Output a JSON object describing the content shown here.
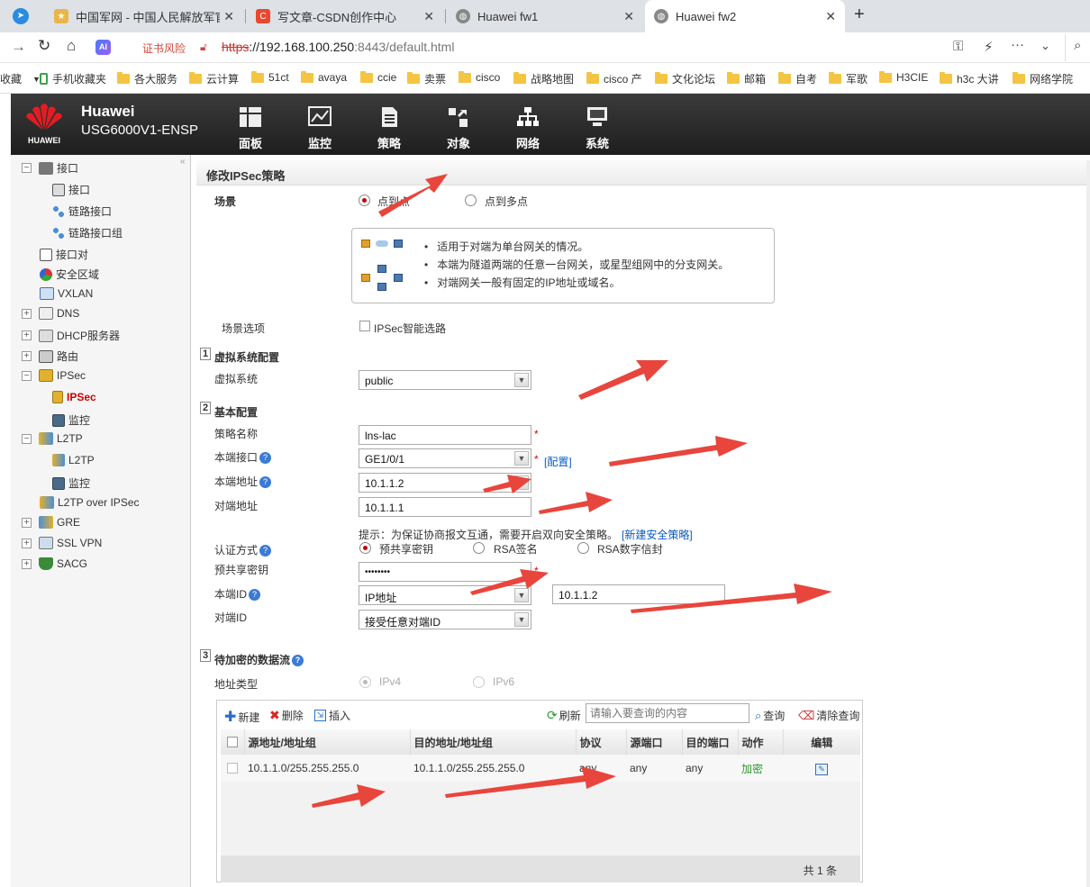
{
  "browser": {
    "tabs": [
      {
        "title": "中国军网 - 中国人民解放军官方"
      },
      {
        "title": "写文章-CSDN创作中心"
      },
      {
        "title": "Huawei fw1"
      },
      {
        "title": "Huawei fw2"
      }
    ],
    "new_tab": "+",
    "cert_warning": "证书风险",
    "url_scheme": "https",
    "url_host": "://192.168.100.250",
    "url_path": ":8443/default.html",
    "ai_label": "AI"
  },
  "bookmarks": [
    "收藏",
    "手机收藏夹",
    "各大服务",
    "云计算",
    "51ct",
    "avaya",
    "ccie",
    "卖票",
    "cisco",
    "战略地图",
    "cisco 产",
    "文化论坛",
    "邮箱",
    "自考",
    "军歌",
    "H3CIE",
    "h3c 大讲",
    "网络学院"
  ],
  "app": {
    "brand": "Huawei",
    "model": "USG6000V1-ENSP",
    "logo_text": "HUAWEI",
    "nav": [
      "面板",
      "监控",
      "策略",
      "对象",
      "网络",
      "系统"
    ]
  },
  "sidebar": {
    "items": [
      {
        "label": "接口"
      },
      {
        "label": "接口"
      },
      {
        "label": "链路接口"
      },
      {
        "label": "链路接口组"
      },
      {
        "label": "接口对"
      },
      {
        "label": "安全区域"
      },
      {
        "label": "VXLAN"
      },
      {
        "label": "DNS"
      },
      {
        "label": "DHCP服务器"
      },
      {
        "label": "路由"
      },
      {
        "label": "IPSec"
      },
      {
        "label": "IPSec"
      },
      {
        "label": "监控"
      },
      {
        "label": "L2TP"
      },
      {
        "label": "L2TP"
      },
      {
        "label": "监控"
      },
      {
        "label": "L2TP over IPSec"
      },
      {
        "label": "GRE"
      },
      {
        "label": "SSL VPN"
      },
      {
        "label": "SACG"
      }
    ]
  },
  "form": {
    "page_title": "修改IPSec策略",
    "scenario_label": "场景",
    "scenario_p2p": "点到点",
    "scenario_p2mp": "点到多点",
    "info_lines": [
      "适用于对端为单台网关的情况。",
      "本端为隧道两端的任意一台网关，或星型组网中的分支网关。",
      "对端网关一般有固定的IP地址或域名。"
    ],
    "scenario_option_label": "场景选项",
    "smart_route": "IPSec智能选路",
    "sec1_num": "1",
    "sec1_title": "虚拟系统配置",
    "vsys_label": "虚拟系统",
    "vsys_value": "public",
    "sec2_num": "2",
    "sec2_title": "基本配置",
    "policy_name_label": "策略名称",
    "policy_name_value": "lns-lac",
    "local_if_label": "本端接口",
    "local_if_value": "GE1/0/1",
    "config_link": "[配置]",
    "local_addr_label": "本端地址",
    "local_addr_value": "10.1.1.2",
    "peer_addr_label": "对端地址",
    "peer_addr_value": "10.1.1.1",
    "hint_text": "提示：为保证协商报文互通，需要开启双向安全策略。",
    "new_policy_link": "[新建安全策略]",
    "auth_label": "认证方式",
    "auth_psk": "预共享密钥",
    "auth_rsa_sig": "RSA签名",
    "auth_rsa_env": "RSA数字信封",
    "psk_label": "预共享密钥",
    "psk_value": "••••••••",
    "local_id_label": "本端ID",
    "local_id_type": "IP地址",
    "local_id_value": "10.1.1.2",
    "peer_id_label": "对端ID",
    "peer_id_value": "接受任意对端ID",
    "sec3_num": "3",
    "sec3_title": "待加密的数据流",
    "addr_type_label": "地址类型",
    "ipv4": "IPv4",
    "ipv6": "IPv6",
    "toolbar": {
      "new": "新建",
      "delete": "删除",
      "insert": "插入",
      "refresh": "刷新",
      "search_placeholder": "请输入要查询的内容",
      "query": "查询",
      "clear_query": "清除查询"
    },
    "table": {
      "headers": [
        "源地址/地址组",
        "目的地址/地址组",
        "协议",
        "源端口",
        "目的端口",
        "动作",
        "编辑"
      ],
      "rows": [
        {
          "src": "10.1.1.0/255.255.255.0",
          "dst": "10.1.1.0/255.255.255.0",
          "proto": "any",
          "sport": "any",
          "dport": "any",
          "action": "加密"
        }
      ],
      "footer": "共 1 条"
    }
  },
  "colors": {
    "accent_red": "#c00000",
    "link_blue": "#0a5bc4",
    "header_dark": "#2a2a2a",
    "action_green": "#2a9a2a",
    "annotation_arrow": "#e8453c"
  }
}
